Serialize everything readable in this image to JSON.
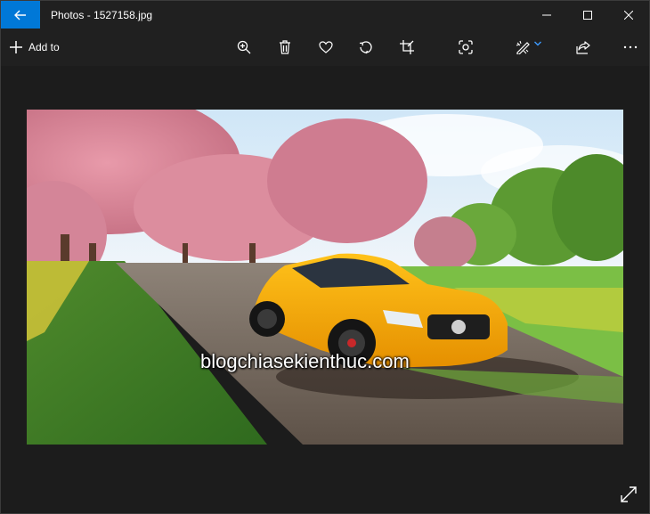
{
  "window": {
    "title": "Photos - 1527158.jpg",
    "accent_color": "#0078d7",
    "controls": [
      "minimize-icon",
      "maximize-icon",
      "close-icon"
    ]
  },
  "toolbar": {
    "add_to_label": "Add to",
    "icons": [
      "zoom-in-icon",
      "delete-icon",
      "favorite-icon",
      "rotate-icon",
      "crop-icon",
      "enhance-icon",
      "edit-icon",
      "share-icon",
      "more-icon"
    ]
  },
  "photo": {
    "watermark": "blogchiasekienthuc.com"
  }
}
